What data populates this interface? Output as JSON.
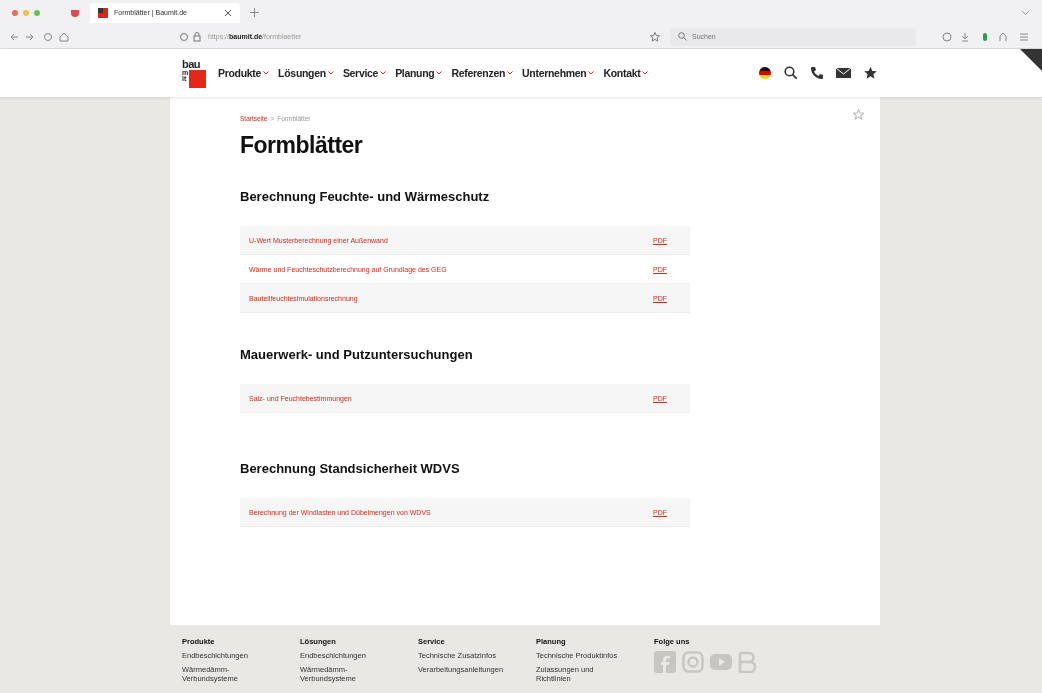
{
  "browser": {
    "tab_title": "Formblätter | Baumit.de",
    "url_prefix": "https://",
    "url_host": "baumit.de",
    "url_path": "/formblaetter",
    "search_placeholder": "Suchen"
  },
  "logo": {
    "top": "bau",
    "side": "mit"
  },
  "nav": [
    {
      "label": "Produkte"
    },
    {
      "label": "Lösungen"
    },
    {
      "label": "Service"
    },
    {
      "label": "Planung"
    },
    {
      "label": "Referenzen"
    },
    {
      "label": "Unternehmen"
    },
    {
      "label": "Kontakt"
    }
  ],
  "breadcrumb": [
    {
      "label": "Startseite",
      "selected": false
    },
    {
      "label": "Formblätter",
      "selected": true
    }
  ],
  "breadcrumb_separator": ">",
  "title": "Formblätter",
  "sections": [
    {
      "heading": "Berechnung Feuchte- und Wärmeschutz",
      "rows": [
        {
          "label": "U-Wert Musterberechnung einer Außenwand",
          "link": "PDF"
        },
        {
          "label": "Wärme und Feuchteschutzberechnung auf Grundlage des GEG",
          "link": "PDF"
        },
        {
          "label": "Bauteilfeuchtesimulationsrechnung",
          "link": "PDF"
        }
      ]
    },
    {
      "heading": "Mauerwerk- und Putzuntersuchungen",
      "rows": [
        {
          "label": "Salz- und Feuchtebestimmungen",
          "link": "PDF"
        }
      ]
    },
    {
      "heading": "Berechnung Standsicherheit WDVS",
      "rows": [
        {
          "label": "Berechnung der Windlasten und Dübelmengen von WDVS",
          "link": "PDF"
        }
      ]
    }
  ],
  "footer": {
    "columns": [
      {
        "heading": "Produkte",
        "links": [
          "Endbeschichtungen",
          "Wärmedämm-Verbundsysteme"
        ]
      },
      {
        "heading": "Lösungen",
        "links": [
          "Endbeschichtungen",
          "Wärmedämm-Verbundsysteme"
        ]
      },
      {
        "heading": "Service",
        "links": [
          "Technische Zusatzinfos",
          "Verarbeitungsanleitungen"
        ]
      },
      {
        "heading": "Planung",
        "links": [
          "Technische Produktinfos",
          "Zulassungen und Richtlinien"
        ]
      }
    ],
    "social_heading": "Folge uns"
  }
}
